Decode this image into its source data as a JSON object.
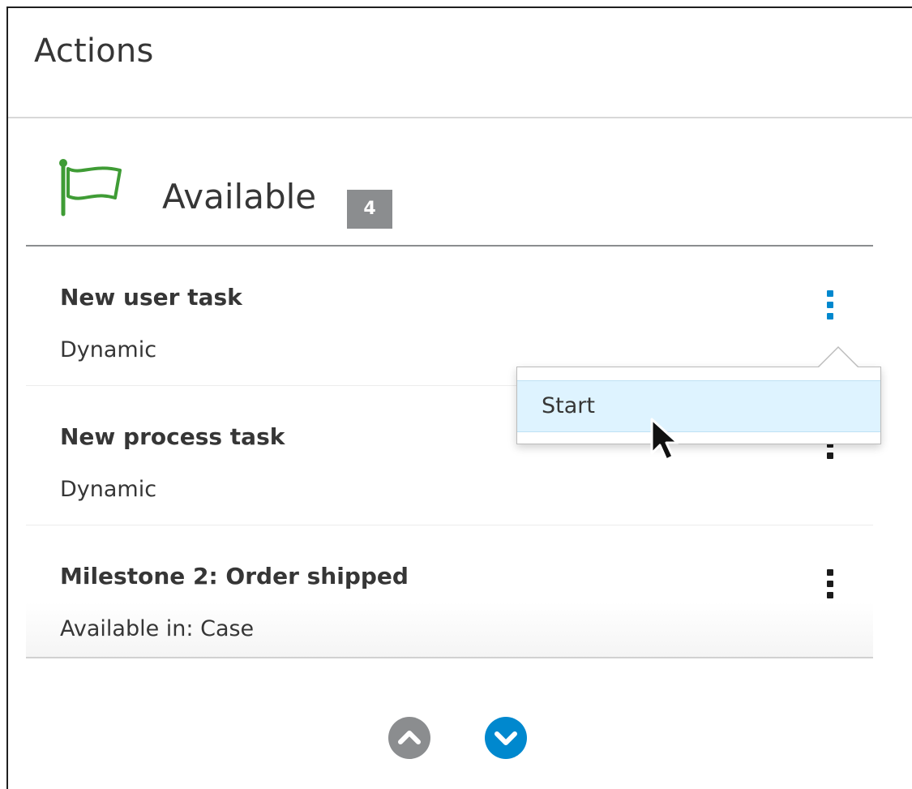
{
  "panel": {
    "title": "Actions"
  },
  "section": {
    "title": "Available",
    "count": "4",
    "icon": "flag-icon",
    "icon_color": "#3f9c35"
  },
  "items": [
    {
      "name": "New user task",
      "sub": "Dynamic",
      "menu_icon": "kebab-icon",
      "menu_active": true
    },
    {
      "name": "New process task",
      "sub": "Dynamic",
      "menu_icon": "kebab-icon",
      "menu_active": false
    },
    {
      "name": "Milestone 2: Order shipped",
      "sub": "Available in: Case",
      "menu_icon": "kebab-icon",
      "menu_active": false
    }
  ],
  "dropdown": {
    "items": [
      {
        "label": "Start"
      }
    ]
  },
  "pager": {
    "up_icon": "chevron-up-icon",
    "down_icon": "chevron-down-icon"
  },
  "colors": {
    "accent": "#0088ce",
    "badge": "#8b8d8f",
    "highlight": "#def3ff",
    "flag": "#3f9c35"
  }
}
